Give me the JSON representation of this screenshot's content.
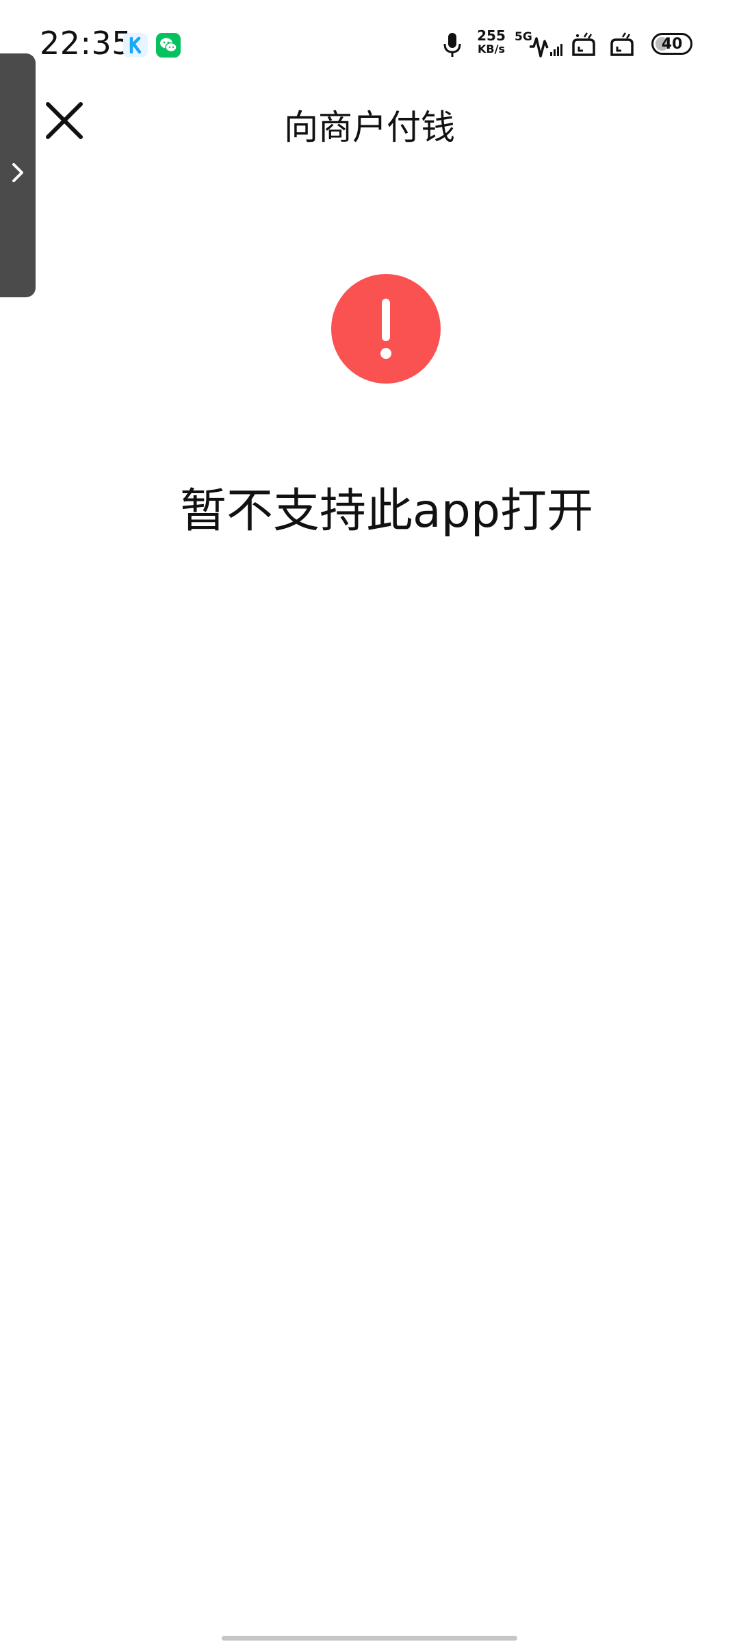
{
  "status_bar": {
    "time": "22:35",
    "notification_icons": [
      "kuaishou-icon",
      "wechat-icon"
    ],
    "network_speed_value": "255",
    "network_speed_unit": "KB/s",
    "network_type": "5G",
    "battery_level": "40",
    "battery_percent": 40,
    "indicator_icons": [
      "microphone-icon",
      "signal-icon",
      "sim-card-icon",
      "sim-card-icon"
    ]
  },
  "header": {
    "title": "向商户付钱",
    "close_icon": "close-icon"
  },
  "error": {
    "icon": "warning-icon",
    "icon_color": "#fa5151",
    "message": "暂不支持此app打开"
  },
  "side_handle": {
    "icon": "chevron-right-icon"
  }
}
